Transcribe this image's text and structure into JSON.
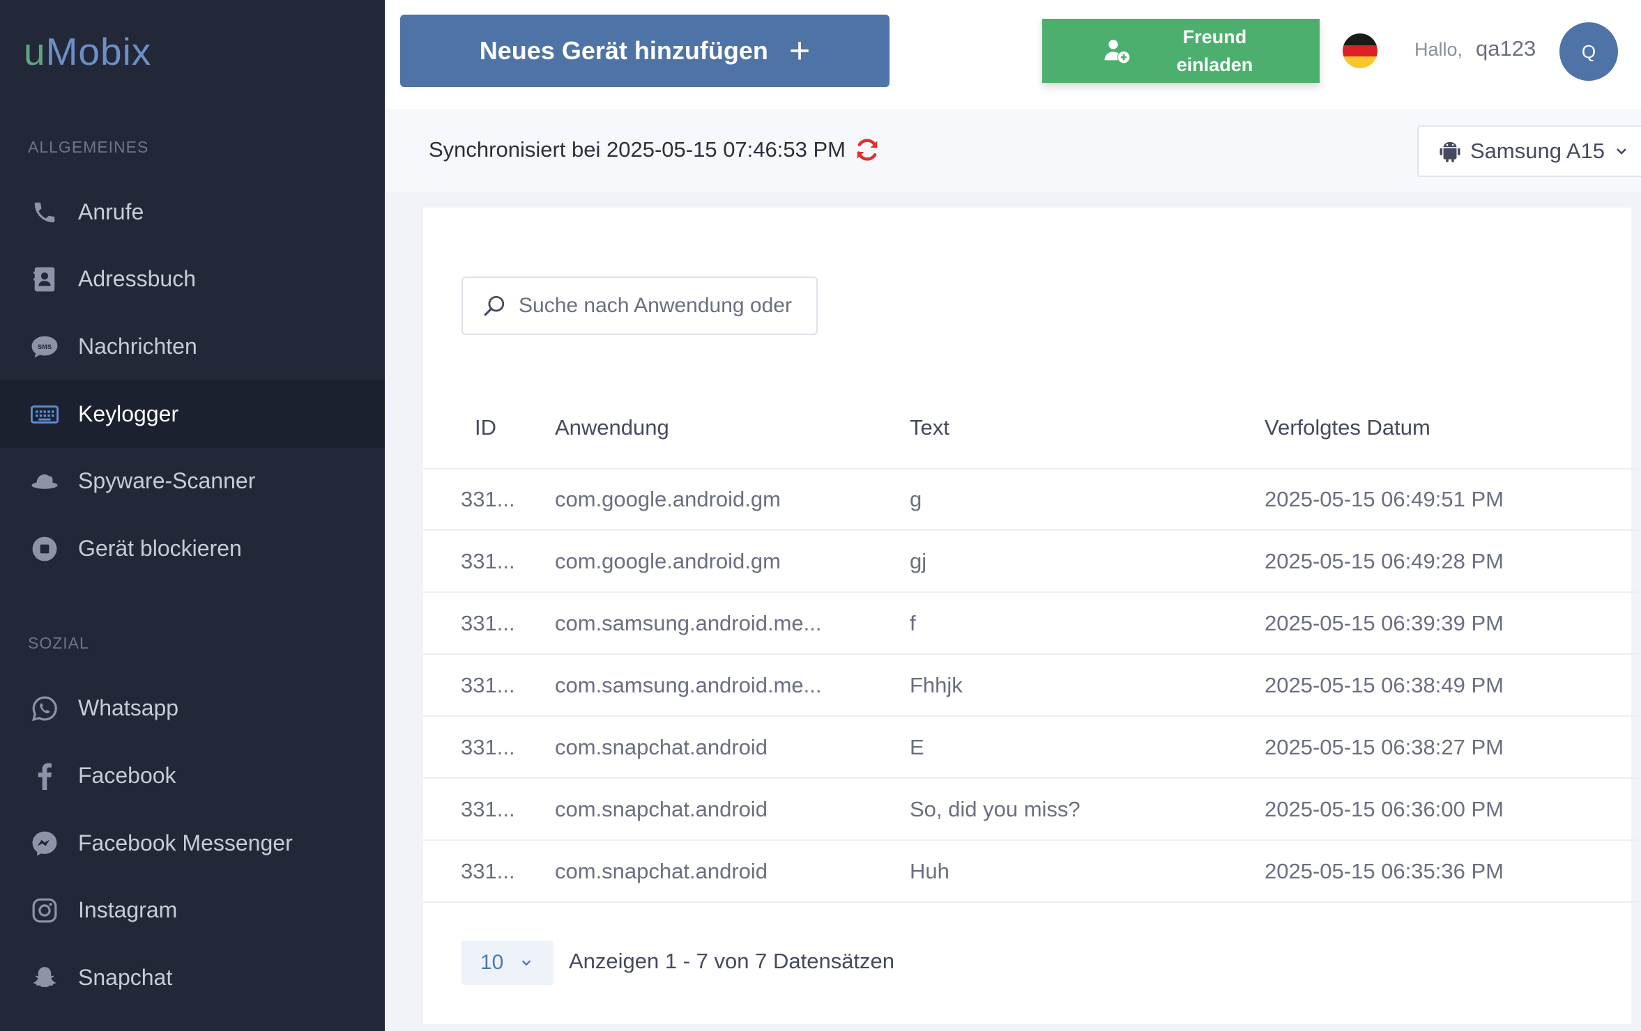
{
  "logo": {
    "part1": "u",
    "part2": "Mobix"
  },
  "sidebar": {
    "section_general": "ALLGEMEINES",
    "general_items": [
      {
        "label": "Anrufe",
        "icon": "phone-icon"
      },
      {
        "label": "Adressbuch",
        "icon": "address-book-icon"
      },
      {
        "label": "Nachrichten",
        "icon": "sms-icon"
      },
      {
        "label": "Keylogger",
        "icon": "keyboard-icon",
        "active": true
      },
      {
        "label": "Spyware-Scanner",
        "icon": "hat-icon"
      },
      {
        "label": "Gerät blockieren",
        "icon": "stop-icon"
      }
    ],
    "section_social": "SOZIAL",
    "social_items": [
      {
        "label": "Whatsapp",
        "icon": "whatsapp-icon"
      },
      {
        "label": "Facebook",
        "icon": "facebook-icon"
      },
      {
        "label": "Facebook Messenger",
        "icon": "messenger-icon"
      },
      {
        "label": "Instagram",
        "icon": "instagram-icon"
      },
      {
        "label": "Snapchat",
        "icon": "snapchat-icon"
      }
    ]
  },
  "header": {
    "add_device_label": "Neues Gerät hinzufügen",
    "add_device_plus": "+",
    "invite_label_line1": "Freund",
    "invite_label_line2": "einladen",
    "greeting": "Hallo,",
    "username": "qa123",
    "avatar_initial": "Q"
  },
  "sync": {
    "text": "Synchronisiert bei 2025-05-15 07:46:53 PM",
    "device": "Samsung A15"
  },
  "search": {
    "placeholder": "Suche nach Anwendung oder Text"
  },
  "table": {
    "headers": [
      "ID",
      "Anwendung",
      "Text",
      "Verfolgtes Datum"
    ],
    "rows": [
      {
        "id": "331...",
        "app": "com.google.android.gm",
        "text": "g",
        "date": "2025-05-15 06:49:51 PM"
      },
      {
        "id": "331...",
        "app": "com.google.android.gm",
        "text": "gj",
        "date": "2025-05-15 06:49:28 PM"
      },
      {
        "id": "331...",
        "app": "com.samsung.android.me...",
        "text": "f",
        "date": "2025-05-15 06:39:39 PM"
      },
      {
        "id": "331...",
        "app": "com.samsung.android.me...",
        "text": "Fhhjk",
        "date": "2025-05-15 06:38:49 PM"
      },
      {
        "id": "331...",
        "app": "com.snapchat.android",
        "text": "E",
        "date": "2025-05-15 06:38:27 PM"
      },
      {
        "id": "331...",
        "app": "com.snapchat.android",
        "text": "So, did you miss?",
        "date": "2025-05-15 06:36:00 PM"
      },
      {
        "id": "331...",
        "app": "com.snapchat.android",
        "text": "Huh",
        "date": "2025-05-15 06:35:36 PM"
      }
    ]
  },
  "pagination": {
    "page_size": "10",
    "info": "Anzeigen 1 - 7 von 7 Datensätzen"
  },
  "colors": {
    "sidebar_bg": "#232838",
    "primary": "#4e73a6",
    "invite_green": "#4caf6e",
    "sync_red": "#e0312b"
  }
}
